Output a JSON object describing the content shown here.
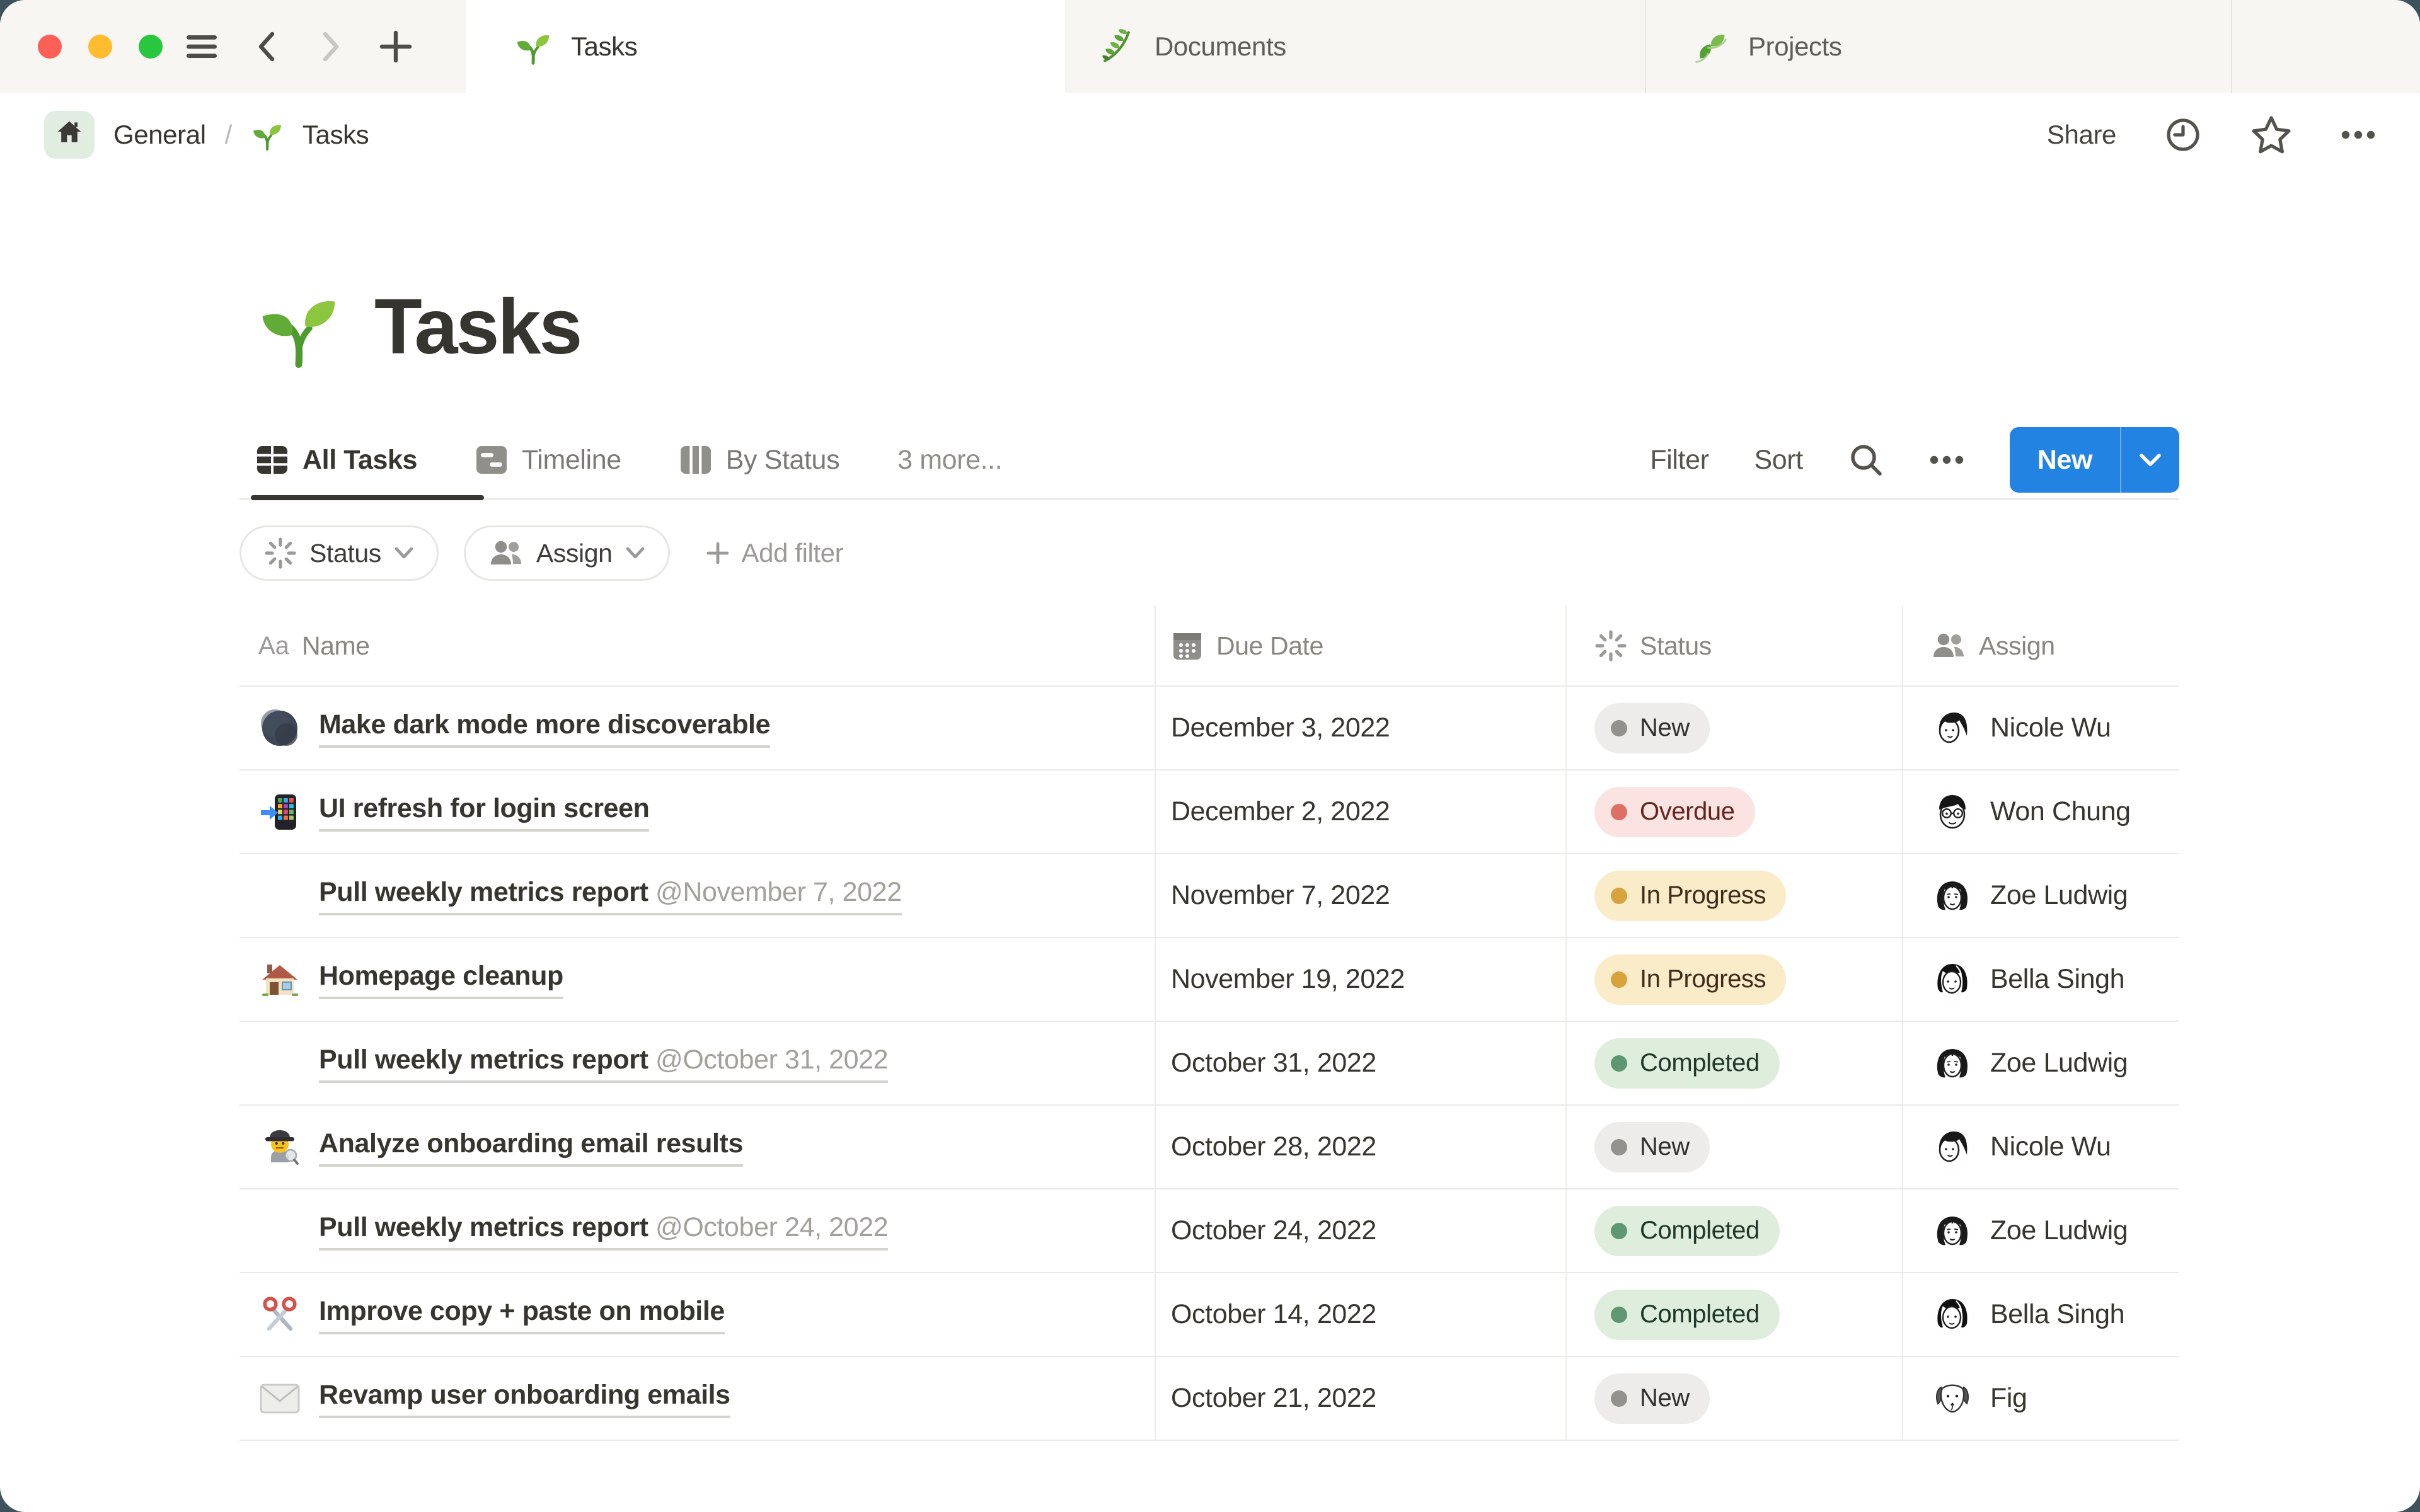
{
  "window": {
    "tabs": [
      {
        "icon": "seedling",
        "label": "Tasks",
        "active": true
      },
      {
        "icon": "herb",
        "label": "Documents",
        "active": false
      },
      {
        "icon": "leaf",
        "label": "Projects",
        "active": false
      }
    ]
  },
  "breadcrumb": {
    "workspace": "General",
    "separator": "/",
    "page_icon": "seedling",
    "page": "Tasks",
    "share_label": "Share"
  },
  "page": {
    "icon": "seedling",
    "title": "Tasks"
  },
  "views": {
    "tabs": [
      {
        "icon": "table-view",
        "label": "All Tasks",
        "active": true
      },
      {
        "icon": "timeline-view",
        "label": "Timeline",
        "active": false
      },
      {
        "icon": "board-view",
        "label": "By Status",
        "active": false
      }
    ],
    "more_label": "3 more...",
    "filter_label": "Filter",
    "sort_label": "Sort",
    "new_label": "New"
  },
  "filter_bar": {
    "chips": [
      {
        "icon": "status-burst",
        "label": "Status"
      },
      {
        "icon": "people",
        "label": "Assign"
      }
    ],
    "add_label": "Add filter"
  },
  "table": {
    "columns": [
      {
        "icon": "aa",
        "label": "Name"
      },
      {
        "icon": "calendar",
        "label": "Due Date"
      },
      {
        "icon": "status-burst",
        "label": "Status"
      },
      {
        "icon": "people",
        "label": "Assign"
      }
    ],
    "rows": [
      {
        "icon": "new-moon",
        "name": "Make dark mode more discoverable",
        "mention": "",
        "due": "December 3, 2022",
        "status": {
          "label": "New",
          "kind": "gray"
        },
        "assignee": {
          "name": "Nicole Wu",
          "avatar": "nicole-wu"
        }
      },
      {
        "icon": "phone-arrow",
        "name": "UI refresh for login screen",
        "mention": "",
        "due": "December 2, 2022",
        "status": {
          "label": "Overdue",
          "kind": "red"
        },
        "assignee": {
          "name": "Won Chung",
          "avatar": "won-chung"
        }
      },
      {
        "icon": "seedling",
        "name": "Pull weekly metrics report ",
        "mention": "@November 7, 2022",
        "due": "November 7, 2022",
        "status": {
          "label": "In Progress",
          "kind": "yellow"
        },
        "assignee": {
          "name": "Zoe Ludwig",
          "avatar": "zoe-ludwig"
        }
      },
      {
        "icon": "house",
        "name": "Homepage cleanup",
        "mention": "",
        "due": "November 19, 2022",
        "status": {
          "label": "In Progress",
          "kind": "yellow"
        },
        "assignee": {
          "name": "Bella Singh",
          "avatar": "bella-singh"
        }
      },
      {
        "icon": "seedling",
        "name": "Pull weekly metrics report ",
        "mention": "@October 31, 2022",
        "due": "October 31, 2022",
        "status": {
          "label": "Completed",
          "kind": "green"
        },
        "assignee": {
          "name": "Zoe Ludwig",
          "avatar": "zoe-ludwig"
        }
      },
      {
        "icon": "detective",
        "name": "Analyze onboarding email results",
        "mention": "",
        "due": "October 28, 2022",
        "status": {
          "label": "New",
          "kind": "gray"
        },
        "assignee": {
          "name": "Nicole Wu",
          "avatar": "nicole-wu"
        }
      },
      {
        "icon": "seedling",
        "name": "Pull weekly metrics report ",
        "mention": "@October 24, 2022",
        "due": "October 24, 2022",
        "status": {
          "label": "Completed",
          "kind": "green"
        },
        "assignee": {
          "name": "Zoe Ludwig",
          "avatar": "zoe-ludwig"
        }
      },
      {
        "icon": "scissors",
        "name": "Improve copy + paste on mobile",
        "mention": "",
        "due": "October 14, 2022",
        "status": {
          "label": "Completed",
          "kind": "green"
        },
        "assignee": {
          "name": "Bella Singh",
          "avatar": "bella-singh"
        }
      },
      {
        "icon": "envelope",
        "name": "Revamp user onboarding emails",
        "mention": "",
        "due": "October 21, 2022",
        "status": {
          "label": "New",
          "kind": "gray"
        },
        "assignee": {
          "name": "Fig",
          "avatar": "fig"
        }
      }
    ]
  },
  "colors": {
    "accent_blue": "#2383E2",
    "traffic": {
      "red": "#FE5F57",
      "yellow": "#FEBC2E",
      "green": "#28C73F"
    },
    "status": {
      "gray": {
        "bg": "#EDECEA",
        "dot": "#93918D",
        "text": "#32302C"
      },
      "red": {
        "bg": "#FAE3E1",
        "dot": "#DE6F64",
        "text": "#64241D"
      },
      "yellow": {
        "bg": "#FAEBC9",
        "dot": "#D6A33C",
        "text": "#3F2C1A"
      },
      "green": {
        "bg": "#DFEDDD",
        "dot": "#5E9772",
        "text": "#1F3829"
      }
    }
  }
}
